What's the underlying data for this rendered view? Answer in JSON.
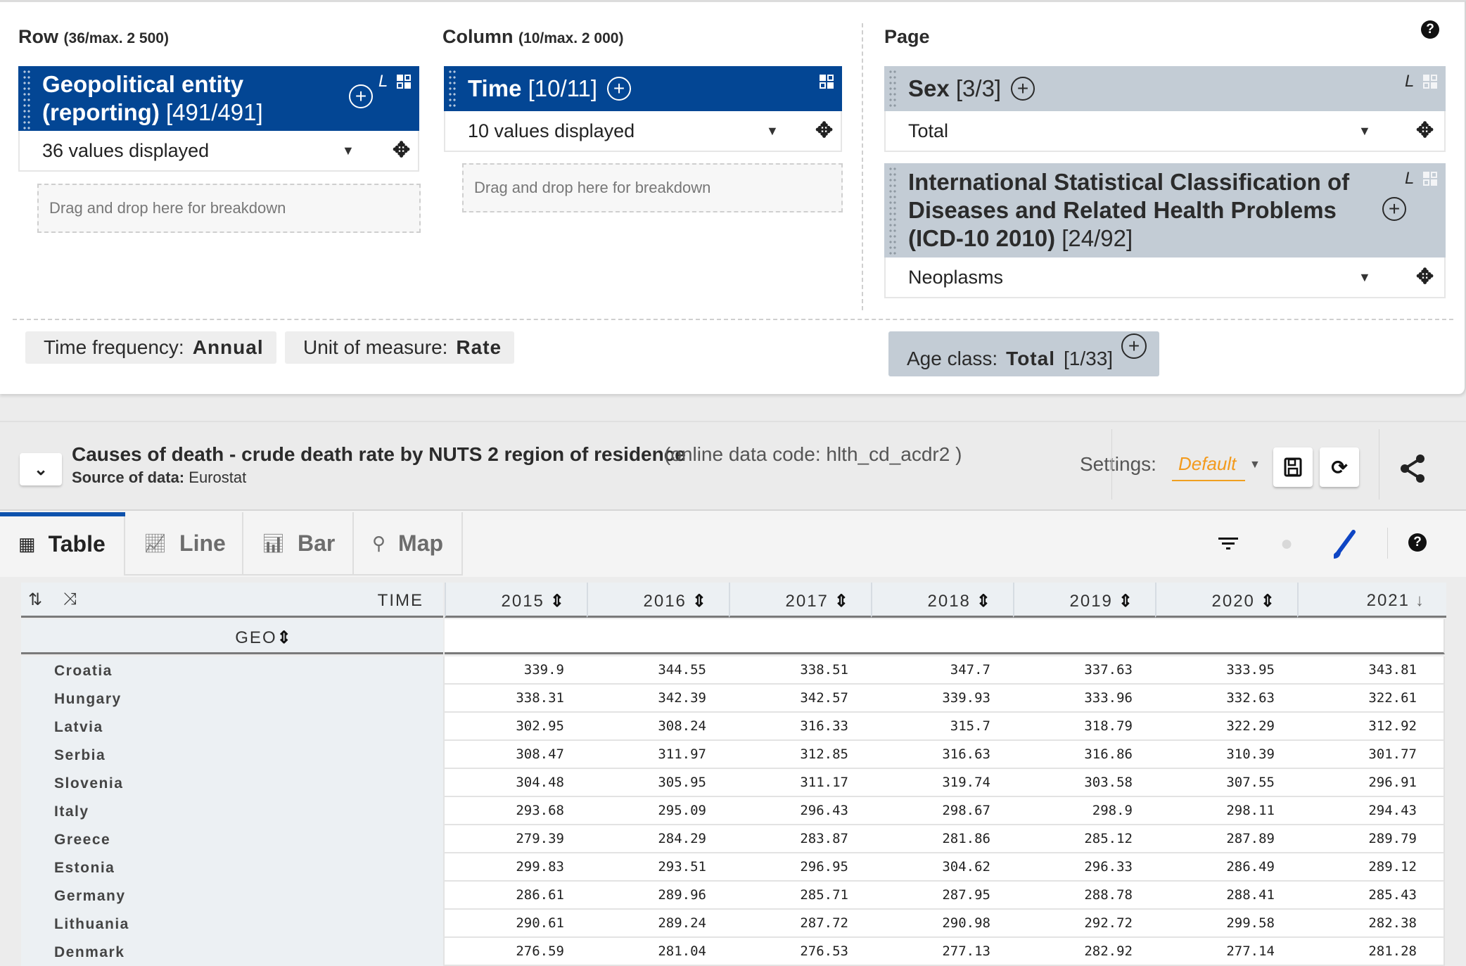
{
  "config": {
    "help_icon": "question-circle-icon",
    "row_zone": {
      "title": "Row",
      "limit": "(36/max. 2 500)"
    },
    "column_zone": {
      "title": "Column",
      "limit": "(10/max. 2 000)"
    },
    "page_zone": {
      "title": "Page"
    },
    "dimensions": {
      "geo": {
        "name": "Geopolitical entity (reporting)",
        "name_line1": "Geopolitical entity",
        "name_line2": "(reporting)",
        "count": "[491/491]",
        "selection": "36 values displayed",
        "l_mark": "L"
      },
      "time": {
        "name": "Time",
        "count": "[10/11]",
        "selection": "10 values displayed"
      },
      "sex": {
        "name": "Sex",
        "count": "[3/3]",
        "selection": "Total",
        "l_mark": "L"
      },
      "icd": {
        "name_line1": "International Statistical Classification of",
        "name_line2": "Diseases and Related Health Problems",
        "name_line3": "(ICD-10 2010)",
        "count": "[24/92]",
        "selection": "Neoplasms",
        "l_mark": "L"
      }
    },
    "drop_zone_text": "Drag and drop here for breakdown",
    "fixed_chips": [
      {
        "label": "Time frequency:",
        "value": "Annual"
      },
      {
        "label": "Unit of measure:",
        "value": "Rate"
      }
    ],
    "age_chip": {
      "label": "Age class:",
      "value": "Total",
      "count": "[1/33]"
    }
  },
  "dataset": {
    "title": "Causes of death - crude death rate by NUTS 2 region of residence",
    "code": "(online data code: hlth_cd_acdr2 )",
    "source_label": "Source of data:",
    "source_value": "Eurostat",
    "settings_label": "Settings:",
    "settings_value": "Default",
    "accent_color": "#f39a1c",
    "brand_color": "#034694"
  },
  "tabs": [
    {
      "label": "Table",
      "icon": "table-icon",
      "active": true
    },
    {
      "label": "Line",
      "icon": "line-chart-icon",
      "active": false
    },
    {
      "label": "Bar",
      "icon": "bar-chart-icon",
      "active": false
    },
    {
      "label": "Map",
      "icon": "map-pin-icon",
      "active": false
    }
  ],
  "table": {
    "time_label": "TIME",
    "geo_label": "GEO",
    "columns": [
      "2015",
      "2016",
      "2017",
      "2018",
      "2019",
      "2020",
      "2021"
    ],
    "sort_state": [
      "both",
      "both",
      "both",
      "both",
      "both",
      "both",
      "desc"
    ],
    "rows": [
      {
        "geo": "Croatia",
        "values": [
          "339.9",
          "344.55",
          "338.51",
          "347.7",
          "337.63",
          "333.95",
          "343.81"
        ]
      },
      {
        "geo": "Hungary",
        "values": [
          "338.31",
          "342.39",
          "342.57",
          "339.93",
          "333.96",
          "332.63",
          "322.61"
        ]
      },
      {
        "geo": "Latvia",
        "values": [
          "302.95",
          "308.24",
          "316.33",
          "315.7",
          "318.79",
          "322.29",
          "312.92"
        ]
      },
      {
        "geo": "Serbia",
        "values": [
          "308.47",
          "311.97",
          "312.85",
          "316.63",
          "316.86",
          "310.39",
          "301.77"
        ]
      },
      {
        "geo": "Slovenia",
        "values": [
          "304.48",
          "305.95",
          "311.17",
          "319.74",
          "303.58",
          "307.55",
          "296.91"
        ]
      },
      {
        "geo": "Italy",
        "values": [
          "293.68",
          "295.09",
          "296.43",
          "298.67",
          "298.9",
          "298.11",
          "294.43"
        ]
      },
      {
        "geo": "Greece",
        "values": [
          "279.39",
          "284.29",
          "283.87",
          "281.86",
          "285.12",
          "287.89",
          "289.79"
        ]
      },
      {
        "geo": "Estonia",
        "values": [
          "299.83",
          "293.51",
          "296.95",
          "304.62",
          "296.33",
          "286.49",
          "289.12"
        ]
      },
      {
        "geo": "Germany",
        "values": [
          "286.61",
          "289.96",
          "285.71",
          "287.95",
          "288.78",
          "288.41",
          "285.43"
        ]
      },
      {
        "geo": "Lithuania",
        "values": [
          "290.61",
          "289.24",
          "287.72",
          "290.98",
          "292.72",
          "299.58",
          "282.38"
        ]
      },
      {
        "geo": "Denmark",
        "values": [
          "276.59",
          "281.04",
          "276.53",
          "277.13",
          "282.92",
          "277.14",
          "281.28"
        ]
      }
    ]
  }
}
